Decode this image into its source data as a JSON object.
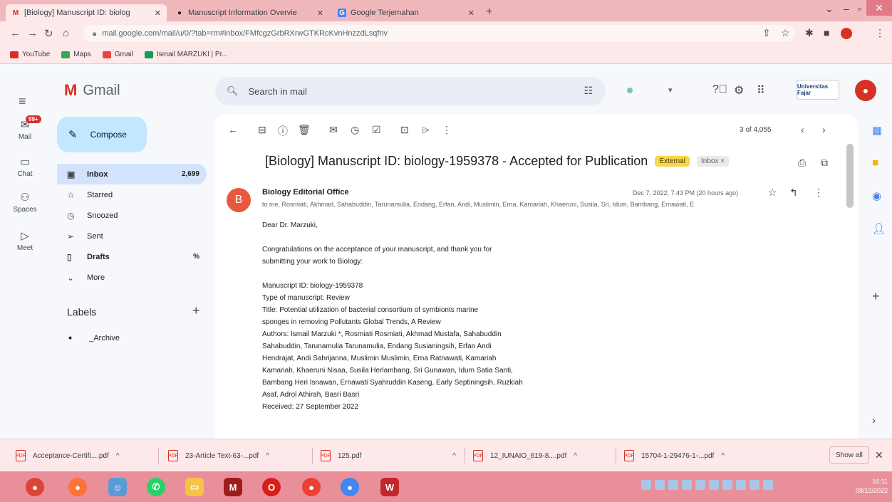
{
  "browser": {
    "tabs": [
      {
        "title": "[Biology] Manuscript ID: biolog",
        "icon": "gmail-icon",
        "active": true
      },
      {
        "title": "Manuscript Information Overvie",
        "icon": "globe-icon",
        "active": false
      },
      {
        "title": "Google Terjemahan",
        "icon": "translate-icon",
        "active": false
      }
    ],
    "url": "mail.google.com/mail/u/0/?tab=rm#inbox/FMfcgzGrbRXrwGTKRcKvnHnzzdLsqfnv",
    "bookmarks": [
      {
        "label": "YouTube",
        "color": "#d93025"
      },
      {
        "label": "Maps",
        "color": "#34a853"
      },
      {
        "label": "Gmail",
        "color": "#ea4335"
      },
      {
        "label": "Ismail MARZUKI | Pr...",
        "color": "#0f9d58"
      }
    ]
  },
  "gmail": {
    "app_name": "Gmail",
    "search_placeholder": "Search in mail",
    "account_label": "Universitas Fajar",
    "rail": {
      "mail": "Mail",
      "mail_badge": "99+",
      "chat": "Chat",
      "spaces": "Spaces",
      "meet": "Meet"
    },
    "compose": "Compose",
    "nav": [
      {
        "label": "Inbox",
        "count": "2,699",
        "icon": "inbox-icon",
        "active": true
      },
      {
        "label": "Starred",
        "count": "",
        "icon": "star-icon",
        "active": false
      },
      {
        "label": "Snoozed",
        "count": "",
        "icon": "clock-icon",
        "active": false
      },
      {
        "label": "Sent",
        "count": "",
        "icon": "send-icon",
        "active": false
      },
      {
        "label": "Drafts",
        "count": "%",
        "icon": "draft-icon",
        "active": false
      },
      {
        "label": "More",
        "count": "",
        "icon": "chevron-down-icon",
        "active": false
      }
    ],
    "labels_heading": "Labels",
    "labels": [
      {
        "label": "_Archive"
      }
    ],
    "page_info": "3 of 4,055",
    "email": {
      "subject": "[Biology] Manuscript ID: biology-1959378 - Accepted for Publication",
      "tag_external": "External",
      "tag_inbox": "Inbox ×",
      "sender_initial": "B",
      "sender": "Biology Editorial Office",
      "recipients": "to me, Rosmiati, Akhmad, Sahabuddin, Tarunamulia, Endang, Erfan, Andi, Muslimin, Erna, Kamariah, Khaeruni, Susila, Sri, Idum, Bambang, Ernawati, E",
      "date": "Dec 7, 2022, 7:43 PM (20 hours ago)",
      "body": [
        "Dear Dr. Marzuki,",
        "",
        "Congratulations on the acceptance of your manuscript, and thank you for",
        "submitting your work to Biology:",
        "",
        "Manuscript ID: biology-1959378",
        "Type of manuscript: Review",
        "Title: Potential utilization of bacterial consortium of symbionts marine",
        "sponges in removing Pollutants Global Trends, A Review",
        "Authors: Ismail Marzuki *, Rosmiati Rosmiati, Akhmad Mustafa, Sahabuddin",
        "Sahabuddin, Tarunamulia Tarunamulia, Endang Susianingsih, Erfan Andi",
        "Hendrajat, Andi Sahrijanna, Muslimin Muslimin, Erna Ratnawati, Kamariah",
        "Kamariah, Khaeruni Nisaa, Susila Herlambang, Sri Gunawan, Idum Satia Santi,",
        "Bambang Heri Isnawan, Ernawati Syahruddin Kaseng, Early Septiningsih, Ruzkiah",
        "Asaf, Adrol Athirah, Basri Basri",
        "Received: 27 September 2022"
      ]
    }
  },
  "downloads": {
    "items": [
      "Acceptance-Certifi....pdf",
      "23-Article Text-63-...pdf",
      "125.pdf",
      "12_IUNAIO_619-8....pdf",
      "15704-1-29476-1-...pdf"
    ],
    "show_all": "Show all"
  },
  "taskbar": {
    "time": "16:11",
    "date": "08/12/2022"
  }
}
